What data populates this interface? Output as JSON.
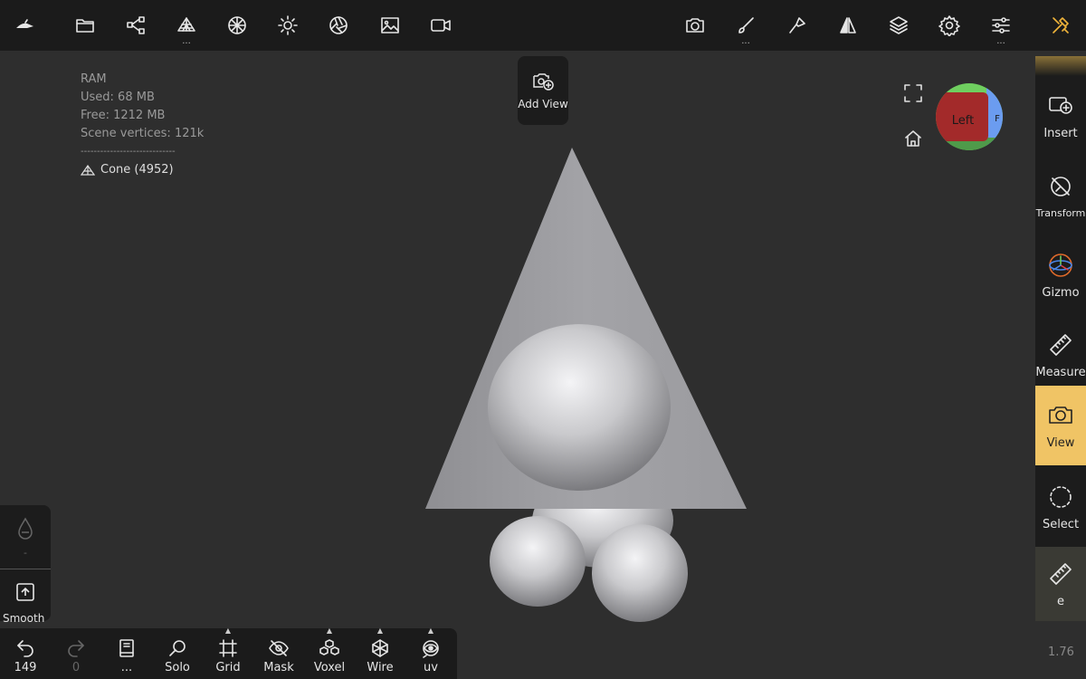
{
  "top_toolbar": {
    "left_icons": [
      "app-logo-icon",
      "folder-icon",
      "scene-graph-icon",
      "mesh-icon",
      "material-sphere-icon",
      "light-sun-icon",
      "camera-aperture-icon",
      "image-icon",
      "video-icon"
    ],
    "right_icons": [
      "camera-icon",
      "brush-icon",
      "paint-icon",
      "symmetry-icon",
      "layers-icon",
      "gear-icon",
      "sliders-icon",
      "tools-icon"
    ],
    "more_indicator": "..."
  },
  "stats": {
    "title": "RAM",
    "used": "Used: 68 MB",
    "free": "Free: 1212 MB",
    "vertices": "Scene vertices: 121k",
    "separator": "-----------------------------",
    "mesh": "Cone (4952)"
  },
  "add_view": {
    "label": "Add View"
  },
  "nav_cube": {
    "face": "Left",
    "side_hint": "F"
  },
  "right_panel": {
    "items": [
      {
        "label": "Insert",
        "icon": "insert-icon"
      },
      {
        "label": "Transform",
        "icon": "transform-icon"
      },
      {
        "label": "Gizmo",
        "icon": "gizmo-icon"
      },
      {
        "label": "Measure",
        "icon": "ruler-icon"
      },
      {
        "label": "View",
        "icon": "camera-icon",
        "active": true
      },
      {
        "label": "Select",
        "icon": "select-icon"
      },
      {
        "label": "e",
        "icon": "ruler-icon"
      }
    ]
  },
  "left_panel": {
    "dash": "-",
    "smooth_label": "Smooth"
  },
  "bottom_bar": {
    "undo_count": "149",
    "redo_count": "0",
    "more_label": "...",
    "solo_label": "Solo",
    "grid_label": "Grid",
    "mask_label": "Mask",
    "voxel_label": "Voxel",
    "wire_label": "Wire",
    "uv_label": "uv"
  },
  "version": "1.76",
  "colors": {
    "accent": "#f0c465",
    "toolbar_bg": "#1b1b1b",
    "viewport_bg": "#2e2e2e",
    "cube_left": "#a32a2a",
    "cube_top": "#6fcf5f",
    "cube_right": "#6b9cf0"
  }
}
